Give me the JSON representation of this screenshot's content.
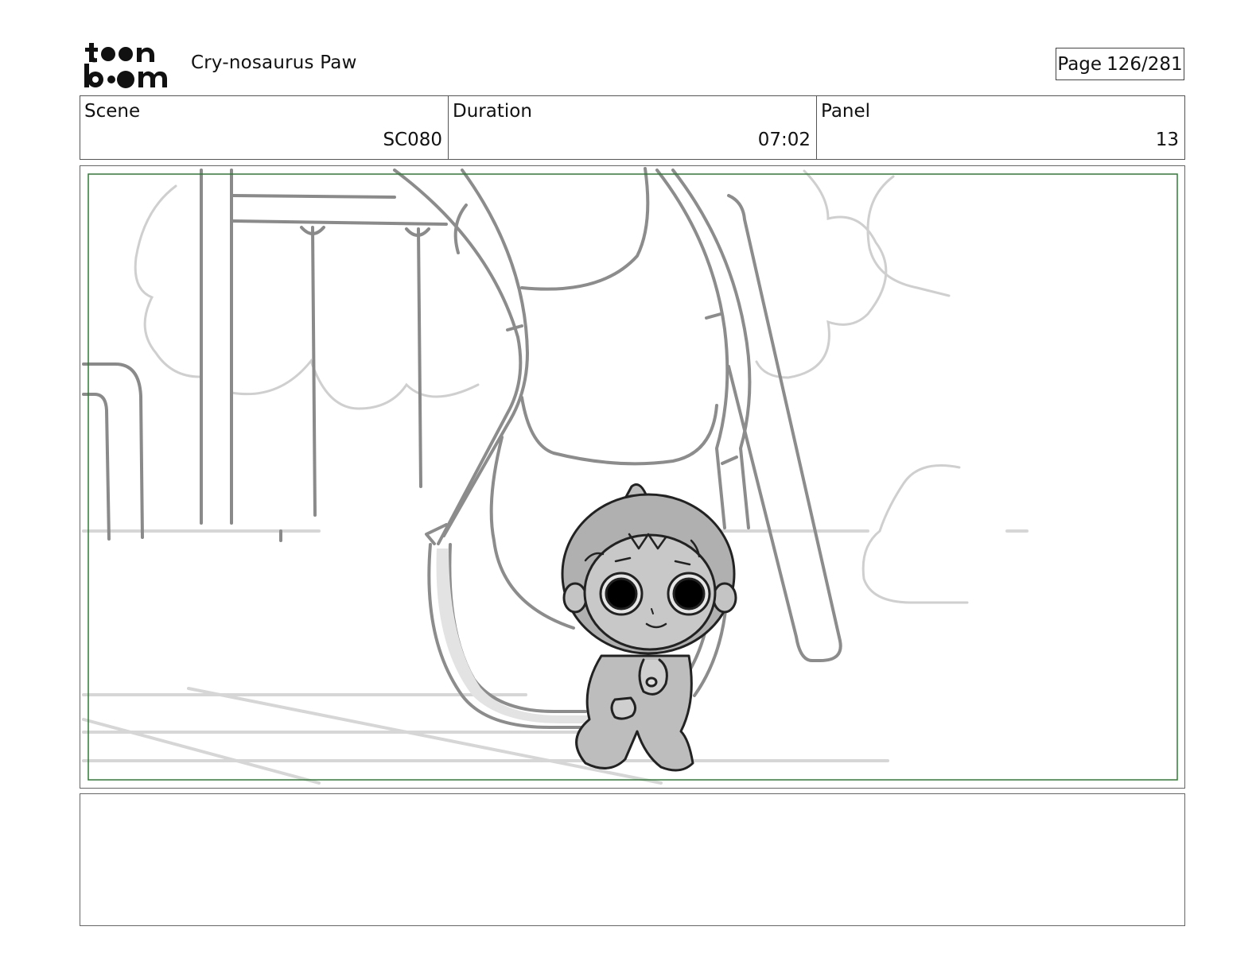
{
  "header": {
    "logo_text": "toon boom",
    "title": "Cry-nosaurus Paw",
    "page_label": "Page",
    "page_value": "126/281"
  },
  "info": {
    "scene_label": "Scene",
    "scene_value": "SC080",
    "duration_label": "Duration",
    "duration_value": "07:02",
    "panel_label": "Panel",
    "panel_value": "13"
  },
  "panel_image": {
    "safe_frame_color": "#2e7d32"
  },
  "notes": {
    "text": ""
  }
}
